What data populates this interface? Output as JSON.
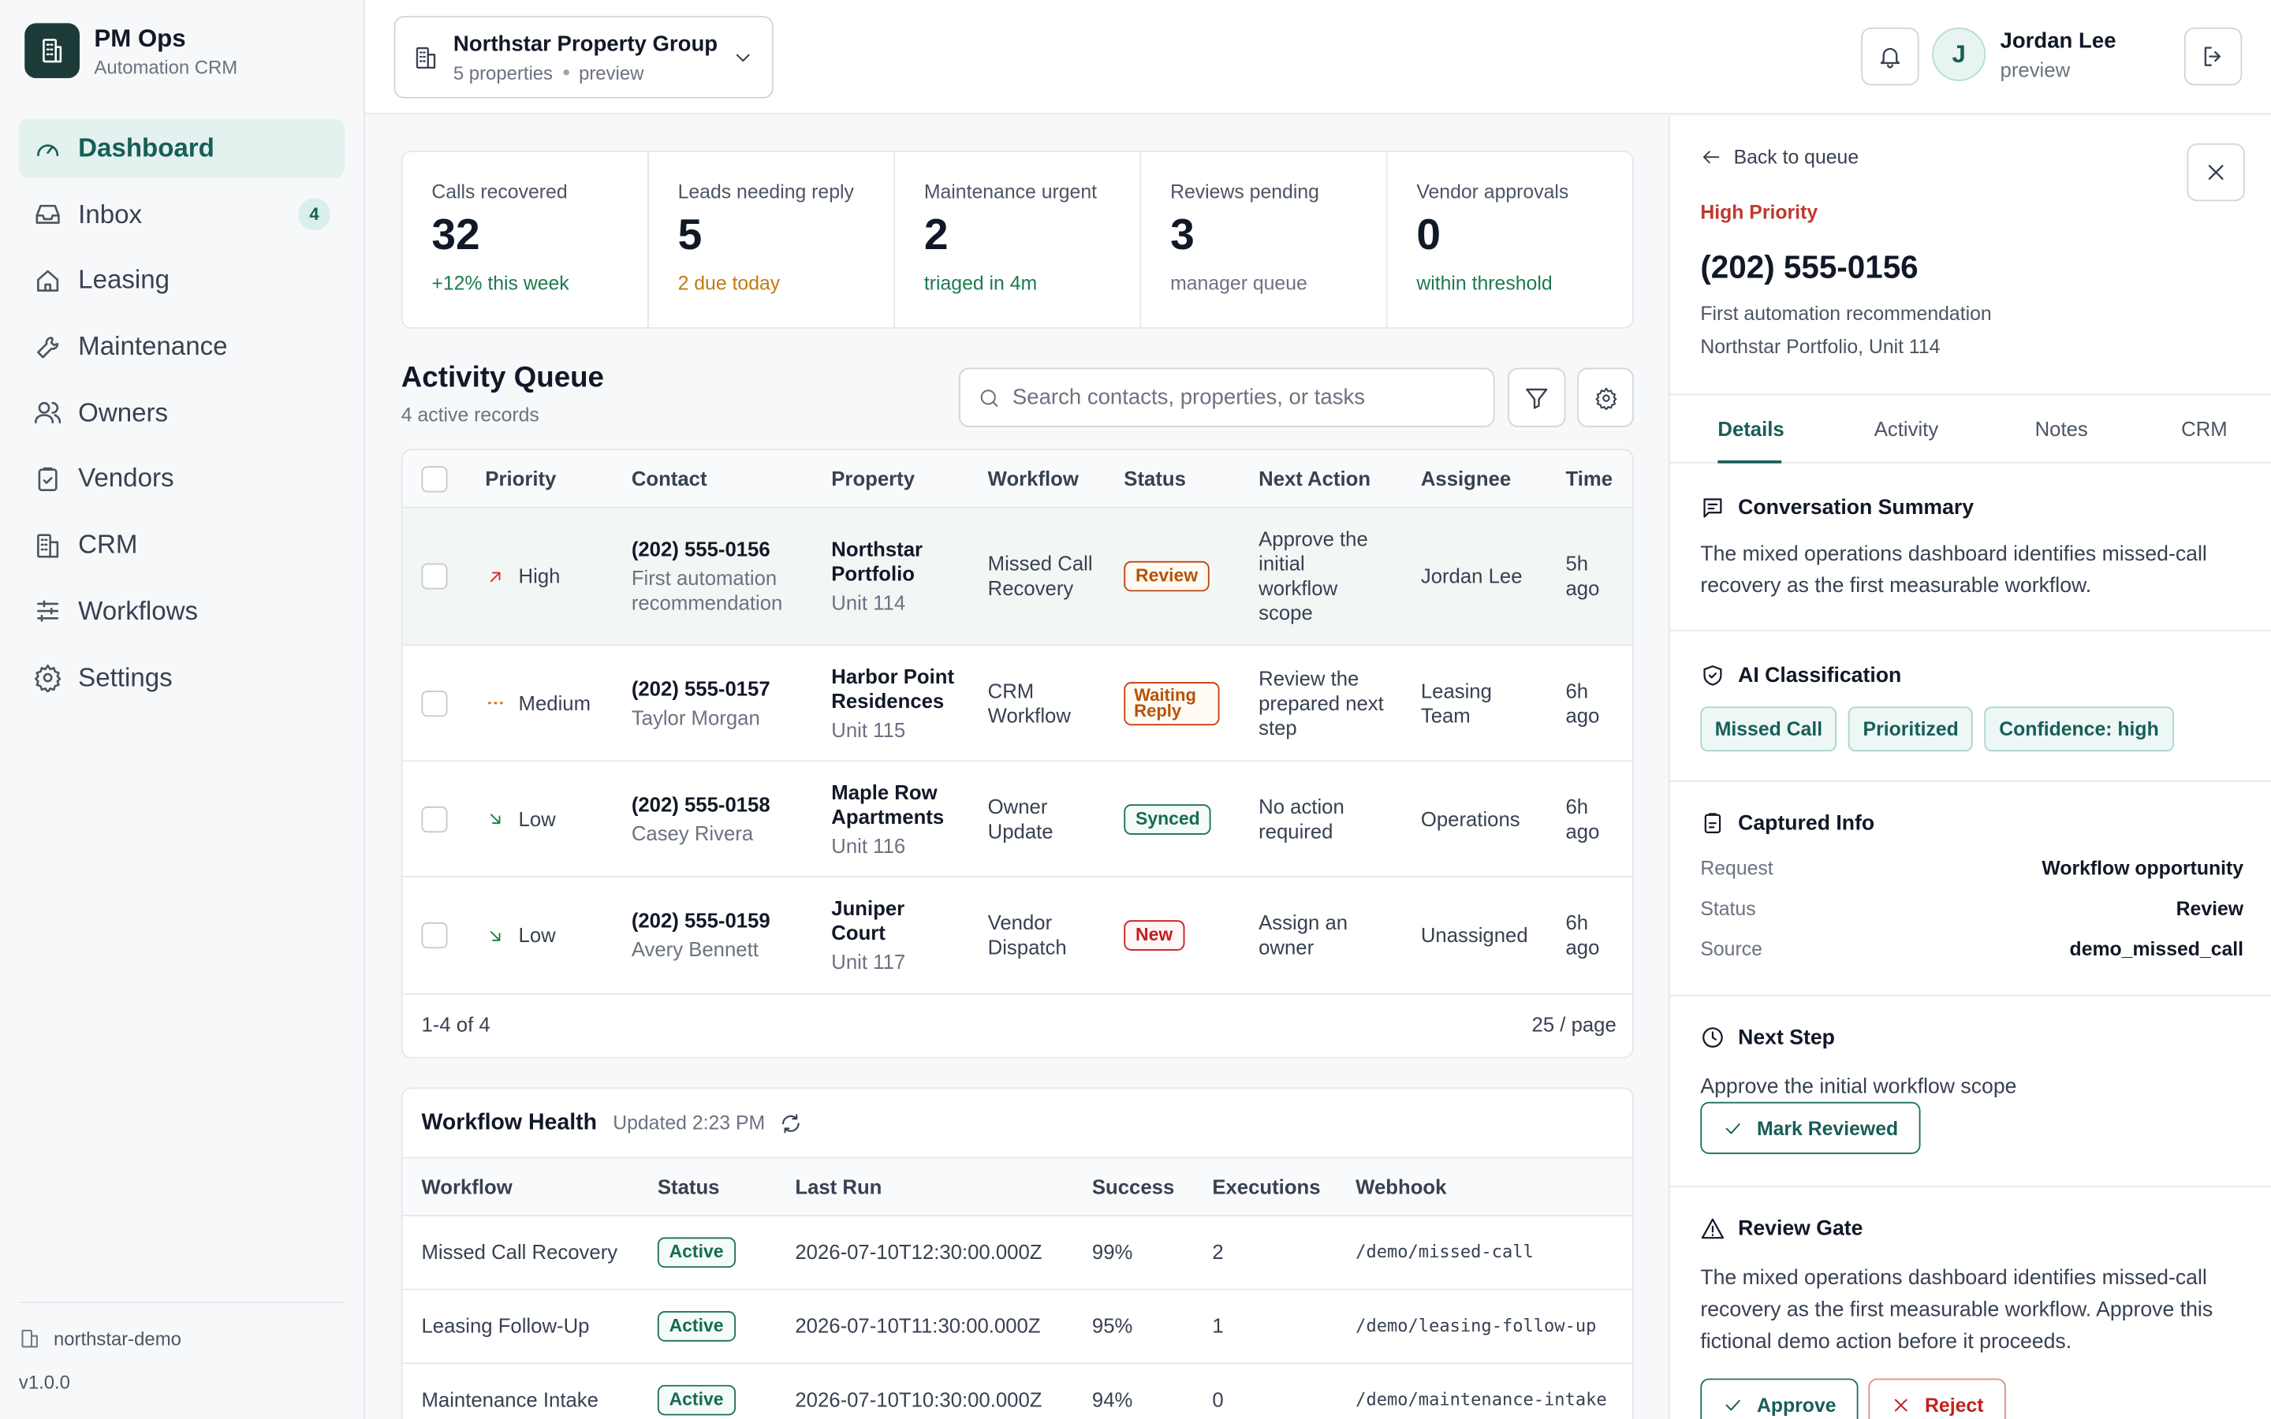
{
  "brand": {
    "name": "PM Ops",
    "subtitle": "Automation CRM"
  },
  "nav": [
    {
      "label": "Dashboard",
      "icon": "gauge-icon",
      "active": true
    },
    {
      "label": "Inbox",
      "icon": "inbox-icon",
      "badge": "4"
    },
    {
      "label": "Leasing",
      "icon": "home-icon"
    },
    {
      "label": "Maintenance",
      "icon": "wrench-icon"
    },
    {
      "label": "Owners",
      "icon": "users-icon"
    },
    {
      "label": "Vendors",
      "icon": "clipboard-check-icon"
    },
    {
      "label": "CRM",
      "icon": "building-icon"
    },
    {
      "label": "Workflows",
      "icon": "sliders-icon"
    },
    {
      "label": "Settings",
      "icon": "gear-icon"
    }
  ],
  "sidebar_footer": {
    "org": "northstar-demo",
    "version": "v1.0.0"
  },
  "org_switcher": {
    "name": "Northstar Property Group",
    "count": "5 properties",
    "mode": "preview"
  },
  "user": {
    "initial": "J",
    "name": "Jordan Lee",
    "role": "preview"
  },
  "stats": [
    {
      "label": "Calls recovered",
      "value": "32",
      "note": "+12% this week",
      "note_color": "#1d7a4f"
    },
    {
      "label": "Leads needing reply",
      "value": "5",
      "note": "2 due today",
      "note_color": "#c27a12"
    },
    {
      "label": "Maintenance urgent",
      "value": "2",
      "note": "triaged in 4m",
      "note_color": "#1d7a4f"
    },
    {
      "label": "Reviews pending",
      "value": "3",
      "note": "manager queue",
      "note_color": "#6b7280"
    },
    {
      "label": "Vendor approvals",
      "value": "0",
      "note": "within threshold",
      "note_color": "#1d7a4f"
    }
  ],
  "queue": {
    "title": "Activity Queue",
    "count": "4 active records",
    "search_placeholder": "Search contacts, properties, or tasks",
    "columns": [
      "Priority",
      "Contact",
      "Property",
      "Workflow",
      "Status",
      "Next Action",
      "Assignee",
      "Time"
    ],
    "rows": [
      {
        "priority": "High",
        "prio_icon": "arrow-up-right-icon",
        "phone": "(202) 555-0156",
        "contact": "First automation recommendation",
        "property": "Northstar Portfolio",
        "unit": "Unit 114",
        "workflow": "Missed Call Recovery",
        "status": "Review",
        "next": "Approve the initial workflow scope",
        "assignee": "Jordan Lee",
        "time": "5h ago"
      },
      {
        "priority": "Medium",
        "prio_icon": "dots-horizontal-icon",
        "phone": "(202) 555-0157",
        "contact": "Taylor Morgan",
        "property": "Harbor Point Residences",
        "unit": "Unit 115",
        "workflow": "CRM Workflow",
        "status": "Waiting Reply",
        "next": "Review the prepared next step",
        "assignee": "Leasing Team",
        "time": "6h ago"
      },
      {
        "priority": "Low",
        "prio_icon": "arrow-down-right-icon",
        "phone": "(202) 555-0158",
        "contact": "Casey Rivera",
        "property": "Maple Row Apartments",
        "unit": "Unit 116",
        "workflow": "Owner Update",
        "status": "Synced",
        "next": "No action required",
        "assignee": "Operations",
        "time": "6h ago"
      },
      {
        "priority": "Low",
        "prio_icon": "arrow-down-right-icon",
        "phone": "(202) 555-0159",
        "contact": "Avery Bennett",
        "property": "Juniper Court",
        "unit": "Unit 117",
        "workflow": "Vendor Dispatch",
        "status": "New",
        "next": "Assign an owner",
        "assignee": "Unassigned",
        "time": "6h ago"
      }
    ],
    "range": "1-4 of 4",
    "per_page": "25 / page"
  },
  "health": {
    "title": "Workflow Health",
    "updated": "Updated 2:23 PM",
    "columns": [
      "Workflow",
      "Status",
      "Last Run",
      "Success",
      "Executions",
      "Webhook"
    ],
    "rows": [
      {
        "workflow": "Missed Call Recovery",
        "status": "Active",
        "last_run": "2026-07-10T12:30:00.000Z",
        "success": "99%",
        "executions": "2",
        "webhook": "/demo/missed-call"
      },
      {
        "workflow": "Leasing Follow-Up",
        "status": "Active",
        "last_run": "2026-07-10T11:30:00.000Z",
        "success": "95%",
        "executions": "1",
        "webhook": "/demo/leasing-follow-up"
      },
      {
        "workflow": "Maintenance Intake",
        "status": "Active",
        "last_run": "2026-07-10T10:30:00.000Z",
        "success": "94%",
        "executions": "0",
        "webhook": "/demo/maintenance-intake"
      }
    ]
  },
  "detail": {
    "back": "Back to queue",
    "priority": "High Priority",
    "phone": "(202) 555-0156",
    "line1": "First automation recommendation",
    "line2": "Northstar Portfolio, Unit 114",
    "tabs": [
      "Details",
      "Activity",
      "Notes",
      "CRM"
    ],
    "summary_title": "Conversation Summary",
    "summary": "The mixed operations dashboard identifies missed-call recovery as the first measurable workflow.",
    "ai_title": "AI Classification",
    "chips": [
      "Missed Call",
      "Prioritized",
      "Confidence: high"
    ],
    "captured_title": "Captured Info",
    "captured": [
      {
        "k": "Request",
        "v": "Workflow opportunity"
      },
      {
        "k": "Status",
        "v": "Review"
      },
      {
        "k": "Source",
        "v": "demo_missed_call"
      }
    ],
    "next_title": "Next Step",
    "next_text": "Approve the initial workflow scope",
    "mark_reviewed": "Mark Reviewed",
    "gate_title": "Review Gate",
    "gate_text": "The mixed operations dashboard identifies missed-call recovery as the first measurable workflow. Approve this fictional demo action before it proceeds.",
    "approve": "Approve",
    "reject": "Reject"
  }
}
